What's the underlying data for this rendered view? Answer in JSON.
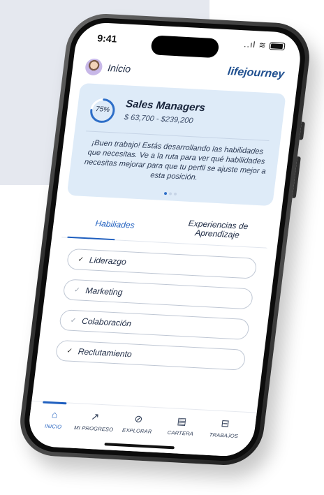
{
  "status_bar": {
    "time": "9:41",
    "signal": "..ıl",
    "wifi": "≋"
  },
  "header": {
    "title": "Inicio",
    "logo": "lifejourney",
    "avatar_icon": "user-avatar"
  },
  "card": {
    "progress_label": "75%",
    "progress_value": 0.75,
    "role_title": "Sales Managers",
    "salary_range": "$ 63,700 - $239,200",
    "message": "¡Buen trabajo! Estás desarrollando las habilidades que necesitas. Ve a la ruta para ver qué habilidades necesitas mejorar para que tu perfil se ajuste mejor a esta posición.",
    "carousel_pages": 3,
    "carousel_active": 0
  },
  "tabs": [
    {
      "label": "Habiliades",
      "active": true
    },
    {
      "label": "Experiencias de Aprendizaje",
      "active": false
    }
  ],
  "skills": [
    {
      "label": "Liderazgo",
      "check": "✓",
      "strong": true
    },
    {
      "label": "Marketing",
      "check": "✓",
      "strong": false
    },
    {
      "label": "Colaboración",
      "check": "✓",
      "strong": false
    },
    {
      "label": "Reclutamiento",
      "check": "✓",
      "strong": true
    }
  ],
  "nav": [
    {
      "label": "INICIO",
      "icon": "home-icon",
      "glyph": "⌂",
      "active": true
    },
    {
      "label": "MI PROGRESO",
      "icon": "progress-chart-icon",
      "glyph": "↗",
      "active": false
    },
    {
      "label": "EXPLORAR",
      "icon": "compass-icon",
      "glyph": "⊘",
      "active": false
    },
    {
      "label": "CARTERA",
      "icon": "wallet-icon",
      "glyph": "▤",
      "active": false
    },
    {
      "label": "TRABAJOS",
      "icon": "briefcase-icon",
      "glyph": "⊟",
      "active": false
    }
  ],
  "colors": {
    "accent": "#1f5fbf",
    "card_bg": "#deebf8",
    "background_block": "#e5e8ef"
  }
}
